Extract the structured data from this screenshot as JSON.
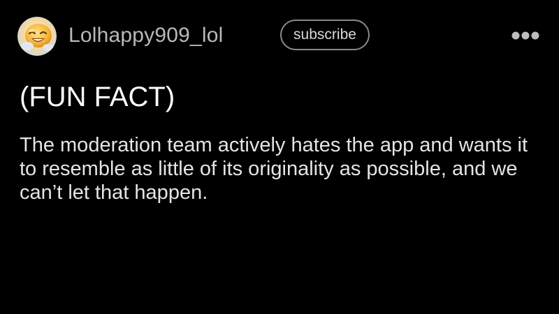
{
  "post": {
    "author": {
      "username": "Lolhappy909_lol",
      "avatar_icon": "smiling-emoji-avatar-icon"
    },
    "subscribe_label": "subscribe",
    "more_icon": "more-options-icon",
    "title": "(FUN FACT)",
    "body": "The moderation team actively hates the app and wants it to resemble as little of its originality as possible, and we can’t let that happen."
  },
  "colors": {
    "background": "#000000",
    "title_text": "#ffffff",
    "body_text": "#e4e4e4",
    "username_text": "#b9b9b9",
    "button_border": "#8a8a8a"
  }
}
